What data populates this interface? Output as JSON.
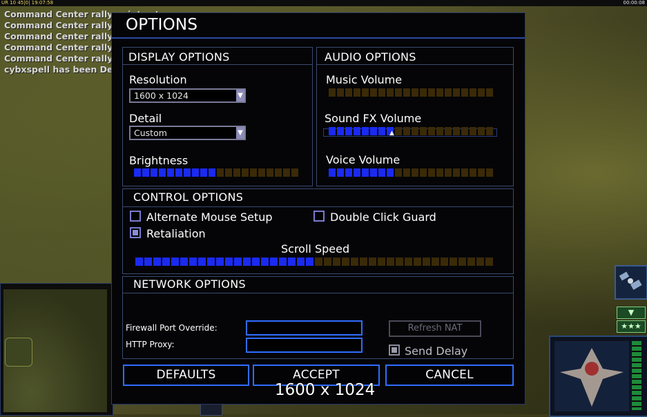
{
  "hud": {
    "top_left": "UR 10 45|0| 19:07:58",
    "top_right": "00:00:08"
  },
  "chat": [
    "Command Center rally point set.",
    "Command Center rally point set.",
    "Command Center rally point set.",
    "Command Center rally point set.",
    "Command Center rally point set.",
    "cybxspell has been Defeated"
  ],
  "dialog": {
    "title": "OPTIONS",
    "display": {
      "heading": "DISPLAY OPTIONS",
      "resolution_label": "Resolution",
      "resolution_value": "1600 x 1024",
      "detail_label": "Detail",
      "detail_value": "Custom",
      "brightness_label": "Brightness",
      "brightness_level": 0.5
    },
    "audio": {
      "heading": "AUDIO OPTIONS",
      "music_label": "Music Volume",
      "music_level": 0,
      "sfx_label": "Sound FX Volume",
      "sfx_level": 0.4,
      "voice_label": "Voice Volume",
      "voice_level": 0.4
    },
    "control": {
      "heading": "CONTROL OPTIONS",
      "alt_mouse_label": "Alternate Mouse Setup",
      "alt_mouse_checked": false,
      "double_click_label": "Double Click Guard",
      "double_click_checked": false,
      "retaliation_label": "Retaliation",
      "retaliation_checked": true,
      "scroll_label": "Scroll Speed",
      "scroll_level": 0.5
    },
    "network": {
      "heading": "NETWORK OPTIONS",
      "firewall_label": "Firewall Port Override:",
      "firewall_value": "",
      "proxy_label": "HTTP Proxy:",
      "proxy_value": "",
      "refresh_label": "Refresh NAT",
      "send_delay_label": "Send Delay",
      "send_delay_checked": true
    },
    "buttons": {
      "defaults": "DEFAULTS",
      "accept": "ACCEPT",
      "cancel": "CANCEL"
    }
  },
  "overlay": {
    "resolution_text": "1600 x 1024"
  },
  "colors": {
    "slider_on": "#1a2af0",
    "slider_off": "#3a2a08",
    "accent_blue": "#2f6dff"
  }
}
